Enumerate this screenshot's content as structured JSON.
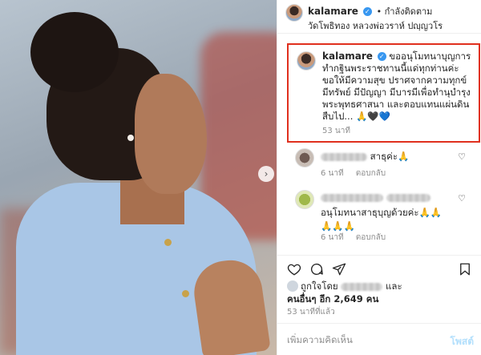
{
  "post": {
    "username": "kalamare",
    "follow_label": "• กำลังติดตาม",
    "location": "วัดโพธิทอง หลวงพ่อวราห์ ปญฺญวโร"
  },
  "caption": {
    "username": "kalamare",
    "text": "ขออนุโมทนาบุญการทำกฐินพระราชทานนี้แด่ทุกท่านค่ะ ขอให้มีความสุข ปราศจากความทุกข์ มีทรัพย์ มีปัญญา มีบารมีเพื่อทำนุบำรุงพระพุทธศาสนา และตอบแทนแผ่นดินสืบไป...",
    "emoji": [
      "🙏",
      "🖤",
      "💙"
    ],
    "time": "53 นาที"
  },
  "comments": [
    {
      "text": "สาธุค่ะ🙏",
      "time": "6 นาที",
      "reply_label": "ตอบกลับ"
    },
    {
      "text_line1": "",
      "text_line2": "อนุโมทนาสาธุบุญด้วยค่ะ🙏🙏",
      "text_line3": "🙏🙏🙏",
      "time": "6 นาที",
      "reply_label": "ตอบกลับ"
    }
  ],
  "likes": {
    "prefix": "ถูกใจโดย",
    "and_label": "และ",
    "others_label": "คนอื่นๆ อีก",
    "count": "2,649",
    "suffix": "คน"
  },
  "post_time": "53 นาทีที่แล้ว",
  "add_comment": {
    "placeholder": "เพิ่มความคิดเห็น",
    "post_label": "โพสต์"
  },
  "colors": {
    "highlight": "#e0301e",
    "verified": "#3897f0",
    "post_button": "#b2dffc"
  }
}
